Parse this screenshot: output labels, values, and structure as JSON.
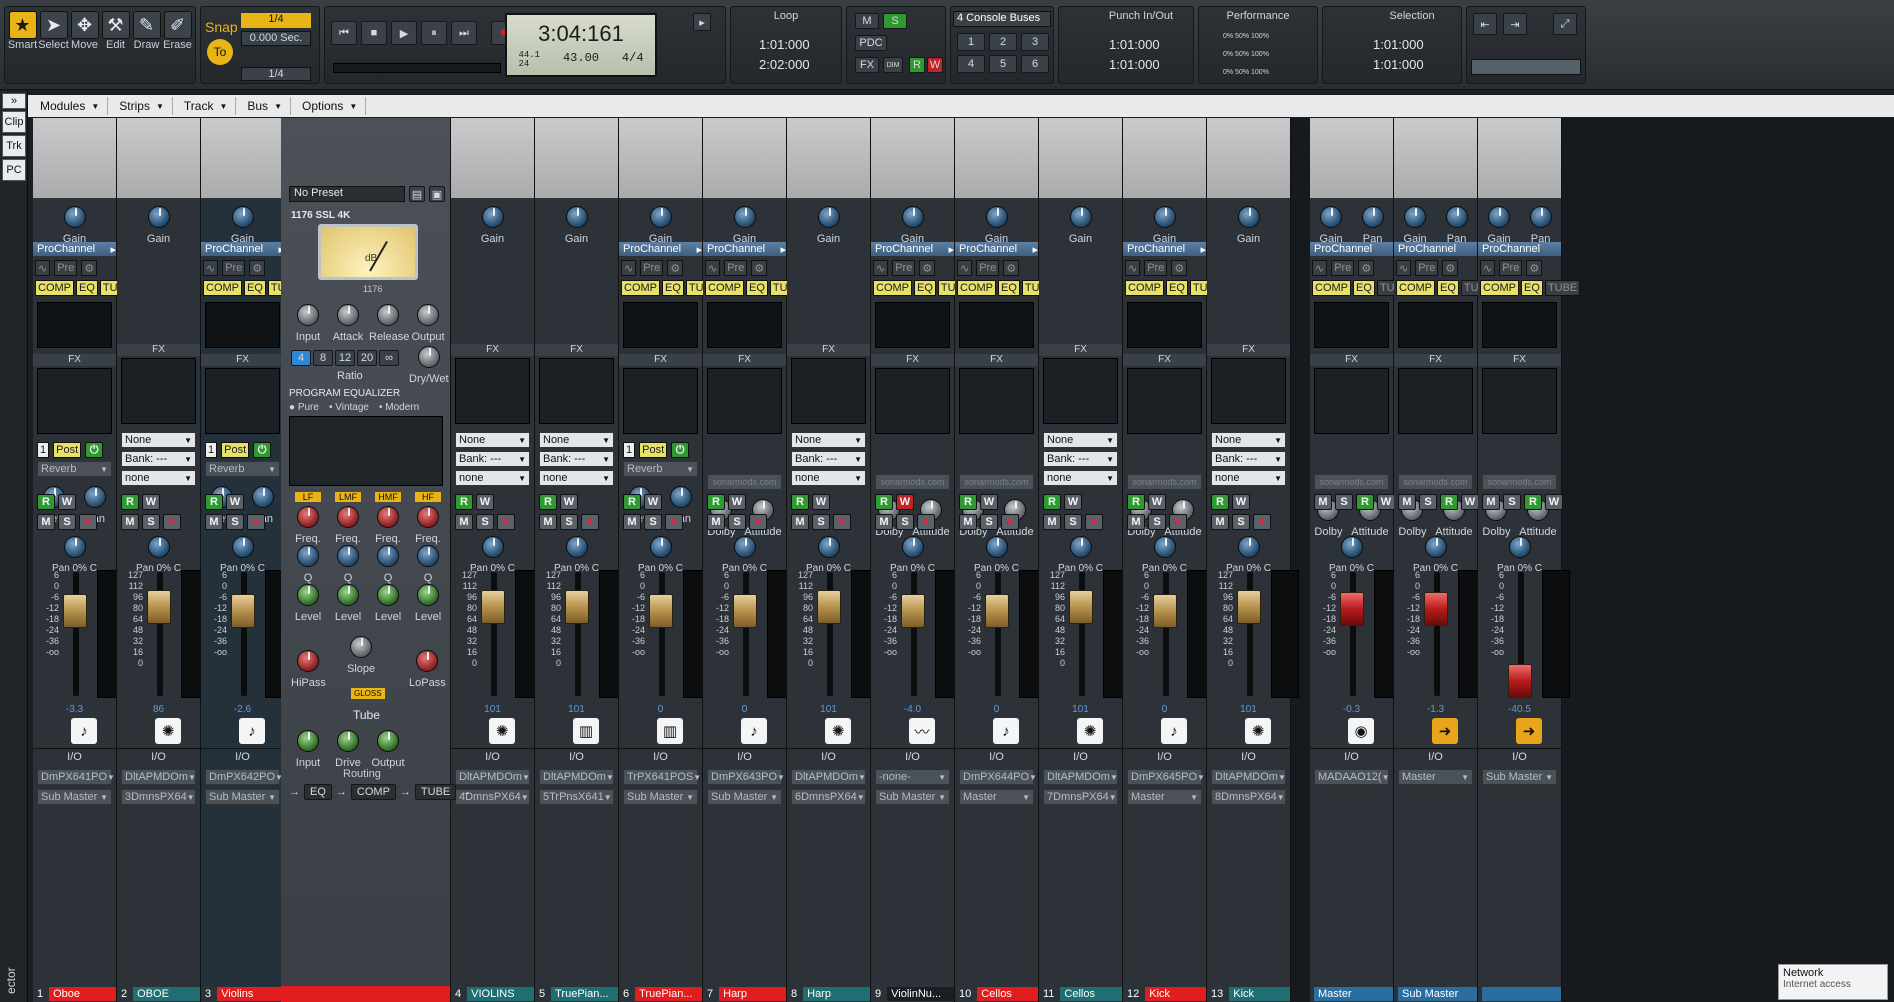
{
  "toolbar": {
    "tools": [
      "Smart",
      "Select",
      "Move",
      "Edit",
      "Draw",
      "Erase"
    ],
    "snap": {
      "label": "Snap",
      "to": "To",
      "value": "1/4",
      "sec": "0.000 Sec.",
      "res": "1/4"
    },
    "time": {
      "now": "3:04:161",
      "tempo": "43.00",
      "sig": "4/4",
      "rate_top": "44.1",
      "rate_bot": "24"
    },
    "loop": {
      "title": "Loop",
      "start": "1:01:000",
      "end": "2:02:000"
    },
    "mixbtns": {
      "m": "M",
      "s": "S",
      "pdc": "PDC",
      "fx": "FX",
      "r": "R",
      "w": "W",
      "dim": "DIM"
    },
    "console": {
      "title": "4 Console Buses",
      "buttons": [
        "1",
        "2",
        "3",
        "4",
        "5",
        "6"
      ]
    },
    "punch": {
      "title": "Punch In/Out",
      "start": "1:01:000",
      "end": "1:01:000"
    },
    "perf": {
      "title": "Performance",
      "r1": "0%  50%  100%",
      "r2": "0%  50%  100%",
      "r3": "0%  50%  100%"
    },
    "selection": {
      "title": "Selection",
      "start": "1:01:000",
      "end": "1:01:000"
    },
    "colors": {
      "accent": "#e8b416",
      "procn": "#4f75a0",
      "red": "#c02426",
      "green": "#2f9a32"
    }
  },
  "side": {
    "tabs": [
      "Clip",
      "Trk",
      "PC"
    ],
    "label": "ector"
  },
  "menu": [
    "Modules",
    "Strips",
    "Track",
    "Bus",
    "Options"
  ],
  "ssl": {
    "preset": "No Preset",
    "module1": "1176  SSL 4K",
    "vu_model": "1176",
    "vu_db": "dB",
    "knobs1": [
      "Input",
      "Attack",
      "Release",
      "Output"
    ],
    "ratio": [
      "4",
      "8",
      "12",
      "20",
      "∞"
    ],
    "ratio_lbl": "Ratio",
    "drywet": "Dry/Wet",
    "peq": "PROGRAM EQUALIZER",
    "modes": [
      "Pure",
      "Vintage",
      "Modern"
    ],
    "bands": [
      "LF",
      "LMF",
      "HMF",
      "HF"
    ],
    "row1": "Freq.",
    "row2": "Q",
    "row3": "Level",
    "slope": "Slope",
    "hipass": "HiPass",
    "lopass": "LoPass",
    "gloss": "GLOSS",
    "tube": "Tube",
    "tubeknobs": [
      "Input",
      "Drive",
      "Output"
    ],
    "routing": "Routing",
    "routes": [
      "EQ",
      "COMP",
      "TUBE"
    ]
  },
  "strips": [
    {
      "n": "1",
      "name": "Oboe",
      "tag": "#e21d1d",
      "pc": true,
      "fx": "Reverb",
      "post": "Post",
      "val": "-3.3",
      "icon": "piano",
      "io": "DmPX641PO",
      "out": "Sub Master",
      "peq": "0.0",
      "sel": false
    },
    {
      "n": "2",
      "name": "OBOE",
      "tag": "#1f6f72",
      "pc": false,
      "fx": "",
      "val": "86",
      "icon": "drum",
      "io": "DltAPMDOm",
      "out": "3DmnsPX64",
      "peq": "0",
      "sel": false
    },
    {
      "n": "3",
      "name": "Violins",
      "tag": "#e21d1d",
      "pc": true,
      "fx": "Reverb",
      "post": "Post",
      "val": "-2.6",
      "icon": "piano",
      "io": "DmPX642PO",
      "out": "Sub Master",
      "peq": "0.0",
      "sel": true
    },
    {
      "n": "4",
      "name": "VIOLINS",
      "tag": "#1f6f72",
      "pc": false,
      "fx": "",
      "val": "101",
      "icon": "drum",
      "io": "DltAPMDOm",
      "out": "4DmnsPX64",
      "peq": "127"
    },
    {
      "n": "5",
      "name": "TruePian...",
      "tag": "#1f6f72",
      "pc": false,
      "fx": "",
      "val": "101",
      "icon": "keys",
      "io": "DltAPMDOm",
      "out": "5TrPnsX641",
      "peq": "93"
    },
    {
      "n": "6",
      "name": "TruePian...",
      "tag": "#e21d1d",
      "pc": true,
      "fx": "Reverb",
      "post": "Post",
      "val": "0",
      "icon": "keys",
      "io": "TrPX641POS",
      "out": "Sub Master",
      "peq": "0.0"
    },
    {
      "n": "7",
      "name": "Harp",
      "tag": "#e21d1d",
      "pc": true,
      "fx": "",
      "val": "0",
      "icon": "piano",
      "io": "DmPX643PO",
      "out": "Sub Master",
      "peq": "0.0"
    },
    {
      "n": "8",
      "name": "Harp",
      "tag": "#1f6f72",
      "pc": false,
      "fx": "",
      "val": "101",
      "icon": "drum",
      "io": "DltAPMDOm",
      "out": "6DmnsPX64",
      "peq": "0"
    },
    {
      "n": "9",
      "name": "ViolinNu...",
      "tag": "#1b1e22",
      "pc": true,
      "fx": "",
      "val": "-4.0",
      "icon": "wave",
      "io": "-none-",
      "out": "Sub Master",
      "peq": "-1.4"
    },
    {
      "n": "10",
      "name": "Cellos",
      "tag": "#e21d1d",
      "pc": true,
      "fx": "",
      "val": "0",
      "icon": "piano",
      "io": "DmPX644PO",
      "out": "Master",
      "peq": "0.0"
    },
    {
      "n": "11",
      "name": "Cellos",
      "tag": "#1f6f72",
      "pc": false,
      "fx": "",
      "val": "101",
      "icon": "drum",
      "io": "DltAPMDOm",
      "out": "7DmnsPX64",
      "peq": "0"
    },
    {
      "n": "12",
      "name": "Kick",
      "tag": "#e21d1d",
      "pc": true,
      "fx": "",
      "val": "0",
      "icon": "piano",
      "io": "DmPX645PO",
      "out": "Master",
      "peq": "0.0"
    },
    {
      "n": "13",
      "name": "Kick",
      "tag": "#1f6f72",
      "pc": false,
      "fx": "",
      "val": "101",
      "icon": "drum",
      "io": "DltAPMDOm",
      "out": "8DmnsPX64",
      "peq": "0"
    }
  ],
  "buses": [
    {
      "name": "Master",
      "tag": "#2a6ea1",
      "val": "-0.3",
      "icon": "speaker",
      "io": "MADAAO12(",
      "out": "",
      "cap": "red"
    },
    {
      "name": "Sub Master",
      "tag": "#2a6ea1",
      "val": "-1.3",
      "icon": "arrow",
      "io": "Master",
      "out": "",
      "cap": "red"
    },
    {
      "name": "",
      "tag": "#2a6ea1",
      "val": "-40.5",
      "icon": "arrow",
      "io": "Sub Master",
      "out": "",
      "cap": "red"
    }
  ],
  "labels": {
    "gain": "Gain",
    "pan": "Pan",
    "fx": "FX",
    "pc": "ProChannel",
    "pre": "Pre",
    "comp": "COMP",
    "eq": "EQ",
    "tube": "TUBE",
    "none": "None",
    "bank": "Bank: ---",
    "none2": "none",
    "lev": "Lev",
    "io": "I/O",
    "sonar": "sonarmods.com",
    "dolby": "Dolby",
    "attitude": "Attitude",
    "pan0c": "0% C",
    "scale": [
      "6",
      "0",
      "-6",
      "-12",
      "-18",
      "-24",
      "-36",
      "-oo"
    ],
    "scale2": [
      "127",
      "112",
      "96",
      "80",
      "64",
      "48",
      "32",
      "16",
      "0"
    ]
  },
  "net": {
    "title": "Network",
    "sub": "Internet access"
  }
}
